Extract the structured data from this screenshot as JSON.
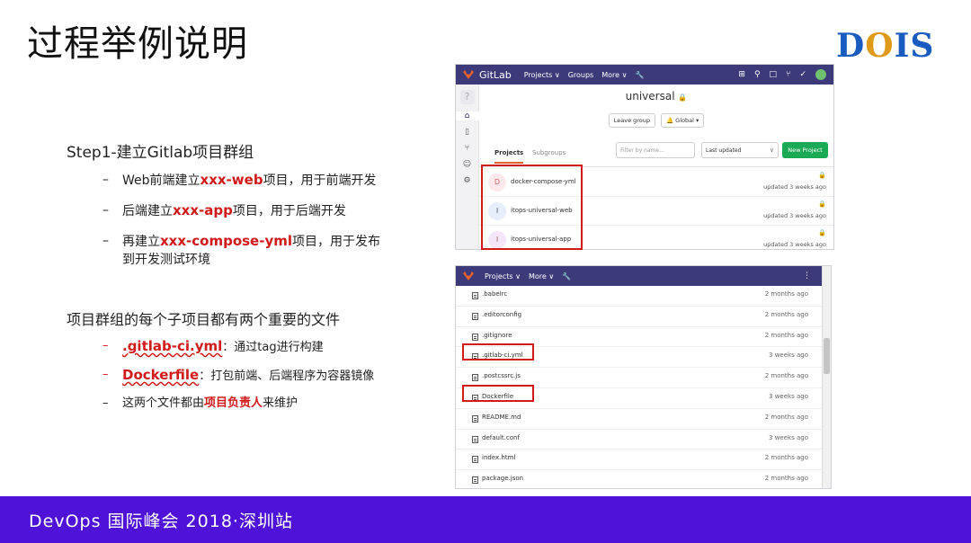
{
  "slide": {
    "title": "过程举例说明",
    "logo_left": "D",
    "logo_o": "O",
    "logo_right": "IS",
    "step_heading": "Step1-建立Gitlab项目群组",
    "steps": [
      {
        "pre": "Web前端建立",
        "highlight": "xxx-web",
        "post": "项目，用于前端开发"
      },
      {
        "pre": "后端建立",
        "highlight": "xxx-app",
        "post": "项目，用于后端开发"
      },
      {
        "pre": "再建立",
        "highlight": "xxx-compose-yml",
        "post": "项目，用于发布"
      }
    ],
    "step3_cont": "到开发测试环境",
    "files_heading": "项目群组的每个子项目都有两个重要的文件",
    "files_bullets": [
      {
        "highlight": ".gitlab-ci.yml",
        "post": "：通过tag进行构建"
      },
      {
        "highlight": "Dockerfile",
        "post": "：打包前端、后端程序为容器镜像"
      }
    ],
    "last_bullet": {
      "pre": "这两个文件都由",
      "highlight": "项目负责人",
      "post": "来维护"
    },
    "bullet_dash": "–",
    "footer": "DevOps 国际峰会 2018·深圳站"
  },
  "gitlab_group": {
    "brand": "GitLab",
    "nav": [
      "Projects ∨",
      "Groups",
      "More ∨"
    ],
    "group_name": "universal",
    "lock": "🔒",
    "leave_group": "Leave group",
    "notify": "🔔 Global ▾",
    "tabs": [
      "Projects",
      "Subgroups"
    ],
    "filter_placeholder": "Filter by name...",
    "sort": "Last updated",
    "new_project": "New Project",
    "projects": [
      {
        "avatar": "D",
        "name": "docker-compose-yml",
        "updated": "updated 3 weeks ago"
      },
      {
        "avatar": "I",
        "name": "itops-universal-web",
        "updated": "updated 3 weeks ago"
      },
      {
        "avatar": "I",
        "name": "itops-universal-app",
        "updated": "updated 3 weeks ago"
      }
    ]
  },
  "gitlab_repo": {
    "nav": [
      "Projects ∨",
      "More ∨"
    ],
    "files": [
      {
        "name": ".babelrc",
        "time": "2 months ago"
      },
      {
        "name": ".editorconfig",
        "time": "2 months ago"
      },
      {
        "name": ".gitignore",
        "time": "2 months ago"
      },
      {
        "name": ".gitlab-ci.yml",
        "time": "3 weeks ago"
      },
      {
        "name": ".postcssrc.js",
        "time": "2 months ago"
      },
      {
        "name": "Dockerfile",
        "time": "3 weeks ago"
      },
      {
        "name": "README.md",
        "time": "2 months ago"
      },
      {
        "name": "default.conf",
        "time": "3 weeks ago"
      },
      {
        "name": "index.html",
        "time": "2 months ago"
      },
      {
        "name": "package.json",
        "time": "2 months ago"
      }
    ]
  }
}
